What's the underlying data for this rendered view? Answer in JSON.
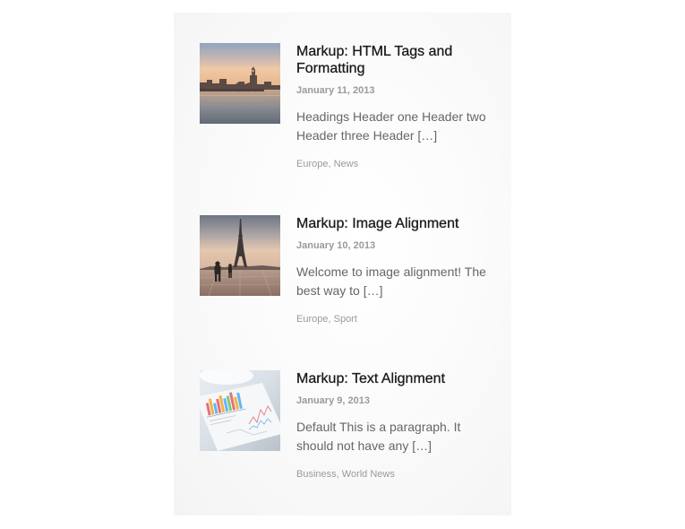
{
  "posts": [
    {
      "title": "Markup: HTML Tags and Formatting",
      "date": "January 11, 2013",
      "excerpt": "Headings Header one Header two Header three Header […]",
      "categories": [
        "Europe",
        "News"
      ],
      "image": "london-big-ben-thumbnail"
    },
    {
      "title": "Markup: Image Alignment",
      "date": "January 10, 2013",
      "excerpt": "Welcome to image alignment! The best way to […]",
      "categories": [
        "Europe",
        "Sport"
      ],
      "image": "paris-eiffel-tower-thumbnail"
    },
    {
      "title": "Markup: Text Alignment",
      "date": "January 9, 2013",
      "excerpt": "Default This is a paragraph. It should not have any […]",
      "categories": [
        "Business",
        "World News"
      ],
      "image": "charts-paper-thumbnail"
    }
  ],
  "category_separator": ", ",
  "colors": {
    "title": "#1a1a1a",
    "meta": "#9a9a9a",
    "excerpt": "#666666",
    "panel": "#f7f7f7"
  }
}
